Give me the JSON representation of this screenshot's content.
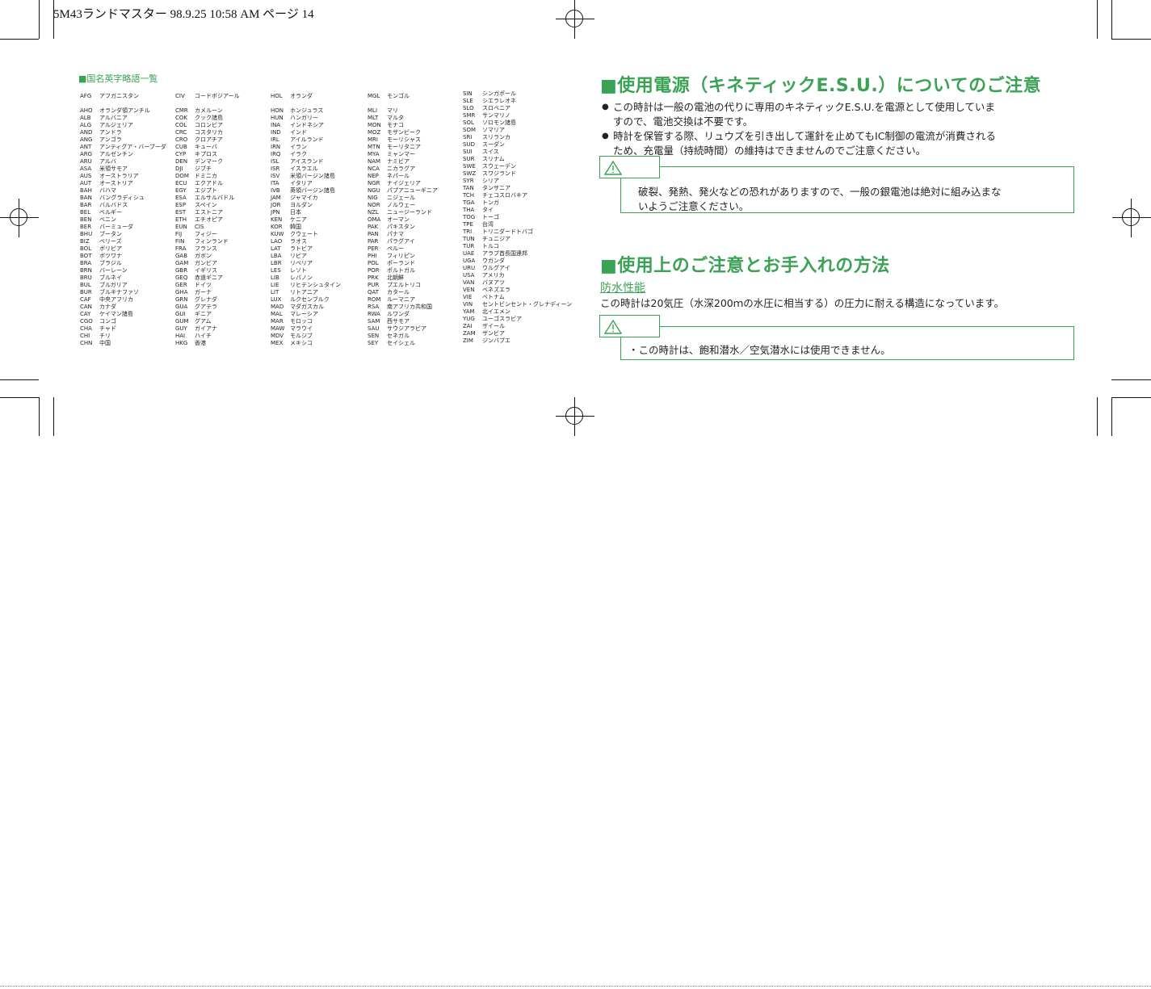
{
  "header": {
    "text": "5M43ランドマスター  98.9.25 10:58 AM   ページ 14"
  },
  "left_page": {
    "title": "■国名英字略語一覧",
    "columns": [
      [
        {
          "code": "AFG",
          "name": "アフガニスタン"
        },
        {
          "code": "",
          "name": ""
        },
        {
          "code": "AHO",
          "name": "オランダ領アンチル"
        },
        {
          "code": "ALB",
          "name": "アルバニア"
        },
        {
          "code": "ALG",
          "name": "アルジェリア"
        },
        {
          "code": "AND",
          "name": "アンドラ"
        },
        {
          "code": "ANG",
          "name": "アンゴラ"
        },
        {
          "code": "ANT",
          "name": "アンティグア・バーブーダ"
        },
        {
          "code": "ARG",
          "name": "アルゼンチン"
        },
        {
          "code": "ARU",
          "name": "アルバ"
        },
        {
          "code": "ASA",
          "name": "米領サモア"
        },
        {
          "code": "AUS",
          "name": "オーストラリア"
        },
        {
          "code": "AUT",
          "name": "オーストリア"
        },
        {
          "code": "BAH",
          "name": "バハマ"
        },
        {
          "code": "BAN",
          "name": "バングラディシュ"
        },
        {
          "code": "BAR",
          "name": "バルバドス"
        },
        {
          "code": "BEL",
          "name": "ベルギー"
        },
        {
          "code": "BEN",
          "name": "ベニン"
        },
        {
          "code": "BER",
          "name": "バーミューダ"
        },
        {
          "code": "BHU",
          "name": "ブータン"
        },
        {
          "code": "BIZ",
          "name": "ベリーズ"
        },
        {
          "code": "BOL",
          "name": "ボリビア"
        },
        {
          "code": "BOT",
          "name": "ボツワナ"
        },
        {
          "code": "BRA",
          "name": "ブラジル"
        },
        {
          "code": "BRN",
          "name": "バーレーン"
        },
        {
          "code": "BRU",
          "name": "ブルネイ"
        },
        {
          "code": "BUL",
          "name": "ブルガリア"
        },
        {
          "code": "BUR",
          "name": "ブルキナファソ"
        },
        {
          "code": "CAF",
          "name": "中央アフリカ"
        },
        {
          "code": "CAN",
          "name": "カナダ"
        },
        {
          "code": "CAY",
          "name": "ケイマン諸島"
        },
        {
          "code": "CGO",
          "name": "コンゴ"
        },
        {
          "code": "CHA",
          "name": "チャド"
        },
        {
          "code": "CHI",
          "name": "チリ"
        },
        {
          "code": "CHN",
          "name": "中国"
        }
      ],
      [
        {
          "code": "CIV",
          "name": "コードボジアール"
        },
        {
          "code": "",
          "name": ""
        },
        {
          "code": "CMR",
          "name": "カメルーン"
        },
        {
          "code": "COK",
          "name": "クック諸島"
        },
        {
          "code": "COL",
          "name": "コロンビア"
        },
        {
          "code": "CRC",
          "name": "コスタリカ"
        },
        {
          "code": "CRO",
          "name": "クロアチア"
        },
        {
          "code": "CUB",
          "name": "キューバ"
        },
        {
          "code": "CYP",
          "name": "キプロス"
        },
        {
          "code": "DEN",
          "name": "デンマーク"
        },
        {
          "code": "DJI",
          "name": "ジブチ"
        },
        {
          "code": "DOM",
          "name": "ドミニカ"
        },
        {
          "code": "ECU",
          "name": "エクアドル"
        },
        {
          "code": "EGY",
          "name": "エジプト"
        },
        {
          "code": "ESA",
          "name": "エルサルバドル"
        },
        {
          "code": "ESP",
          "name": "スペイン"
        },
        {
          "code": "EST",
          "name": "エストニア"
        },
        {
          "code": "ETH",
          "name": "エチオピア"
        },
        {
          "code": "EUN",
          "name": "CIS"
        },
        {
          "code": "FIJ",
          "name": "フィジー"
        },
        {
          "code": "FIN",
          "name": "フィンランド"
        },
        {
          "code": "FRA",
          "name": "フランス"
        },
        {
          "code": "GAB",
          "name": "ガボン"
        },
        {
          "code": "GAM",
          "name": "ガンビア"
        },
        {
          "code": "GBR",
          "name": "イギリス"
        },
        {
          "code": "GEQ",
          "name": "赤道ギニア"
        },
        {
          "code": "GER",
          "name": "ドイツ"
        },
        {
          "code": "GHA",
          "name": "ガーナ"
        },
        {
          "code": "GRN",
          "name": "グレナダ"
        },
        {
          "code": "GUA",
          "name": "グアテラ"
        },
        {
          "code": "GUI",
          "name": "ギニア"
        },
        {
          "code": "GUM",
          "name": "グアム"
        },
        {
          "code": "GUY",
          "name": "ガイアナ"
        },
        {
          "code": "HAI",
          "name": "ハイチ"
        },
        {
          "code": "HKG",
          "name": "香港"
        }
      ],
      [
        {
          "code": "HOL",
          "name": "オランダ"
        },
        {
          "code": "",
          "name": ""
        },
        {
          "code": "HON",
          "name": "ホンジュラス"
        },
        {
          "code": "HUN",
          "name": "ハンガリー"
        },
        {
          "code": "INA",
          "name": "インドネシア"
        },
        {
          "code": "IND",
          "name": "インド"
        },
        {
          "code": "IRL",
          "name": "アイルランド"
        },
        {
          "code": "IRN",
          "name": "イラン"
        },
        {
          "code": "IRQ",
          "name": "イラク"
        },
        {
          "code": "ISL",
          "name": "アイスランド"
        },
        {
          "code": "ISR",
          "name": "イスラエル"
        },
        {
          "code": "ISV",
          "name": "米領バージン諸島"
        },
        {
          "code": "ITA",
          "name": "イタリア"
        },
        {
          "code": "IVB",
          "name": "英領バージン諸島"
        },
        {
          "code": "JAM",
          "name": "ジャマイカ"
        },
        {
          "code": "JOR",
          "name": "ヨルダン"
        },
        {
          "code": "JPN",
          "name": "日本"
        },
        {
          "code": "KEN",
          "name": "ケニア"
        },
        {
          "code": "KOR",
          "name": "韓国"
        },
        {
          "code": "KUW",
          "name": "クウェート"
        },
        {
          "code": "LAO",
          "name": "ラオス"
        },
        {
          "code": "LAT",
          "name": "ラトビア"
        },
        {
          "code": "LBA",
          "name": "リビア"
        },
        {
          "code": "LBR",
          "name": "リベリア"
        },
        {
          "code": "LES",
          "name": "レソト"
        },
        {
          "code": "LIB",
          "name": "レバノン"
        },
        {
          "code": "LIE",
          "name": "リヒテンシュタイン"
        },
        {
          "code": "LIT",
          "name": "リトアニア"
        },
        {
          "code": "LUX",
          "name": "ルクセンブルク"
        },
        {
          "code": "MAD",
          "name": "マダガスカル"
        },
        {
          "code": "MAL",
          "name": "マレーシア"
        },
        {
          "code": "MAR",
          "name": "モロッコ"
        },
        {
          "code": "MAW",
          "name": "マラウイ"
        },
        {
          "code": "MDV",
          "name": "モルジブ"
        },
        {
          "code": "MEX",
          "name": "メキシコ"
        }
      ],
      [
        {
          "code": "MGL",
          "name": "モンゴル"
        },
        {
          "code": "",
          "name": ""
        },
        {
          "code": "MLI",
          "name": "マリ"
        },
        {
          "code": "MLT",
          "name": "マルタ"
        },
        {
          "code": "MON",
          "name": "モナコ"
        },
        {
          "code": "MOZ",
          "name": "モザンビーク"
        },
        {
          "code": "MRI",
          "name": "モーリシャス"
        },
        {
          "code": "MTN",
          "name": "モーリタニア"
        },
        {
          "code": "MYA",
          "name": "ミャンマー"
        },
        {
          "code": "NAM",
          "name": "ナミビア"
        },
        {
          "code": "NCA",
          "name": "ニカラグア"
        },
        {
          "code": "NEP",
          "name": "ネパール"
        },
        {
          "code": "NGR",
          "name": "ナイジェリア"
        },
        {
          "code": "NGU",
          "name": "パプアニューギニア"
        },
        {
          "code": "NIG",
          "name": "ニジェール"
        },
        {
          "code": "NOR",
          "name": "ノルウェー"
        },
        {
          "code": "NZL",
          "name": "ニュージーランド"
        },
        {
          "code": "OMA",
          "name": "オーマン"
        },
        {
          "code": "PAK",
          "name": "パキスタン"
        },
        {
          "code": "PAN",
          "name": "パナマ"
        },
        {
          "code": "PAR",
          "name": "パラグアイ"
        },
        {
          "code": "PER",
          "name": "ペルー"
        },
        {
          "code": "PHI",
          "name": "フィリピン"
        },
        {
          "code": "POL",
          "name": "ポーランド"
        },
        {
          "code": "POR",
          "name": "ポルトガル"
        },
        {
          "code": "PRK",
          "name": "北朝鮮"
        },
        {
          "code": "PUR",
          "name": "プエルトリコ"
        },
        {
          "code": "QAT",
          "name": "カタール"
        },
        {
          "code": "ROM",
          "name": "ルーマニア"
        },
        {
          "code": "RSA",
          "name": "南アフリカ共和国"
        },
        {
          "code": "RWA",
          "name": "ルワンダ"
        },
        {
          "code": "SAM",
          "name": "西サモア"
        },
        {
          "code": "SAU",
          "name": "サウジアラビア"
        },
        {
          "code": "SEN",
          "name": "セネガル"
        },
        {
          "code": "SEY",
          "name": "セイシェル"
        }
      ],
      [
        {
          "code": "SIN",
          "name": "シンガポール"
        },
        {
          "code": "SLE",
          "name": "シエラレオネ"
        },
        {
          "code": "SLO",
          "name": "スロベニア"
        },
        {
          "code": "SMR",
          "name": "サンマリノ"
        },
        {
          "code": "SOL",
          "name": "ソロモン諸島"
        },
        {
          "code": "SOM",
          "name": "ソマリア"
        },
        {
          "code": "SRI",
          "name": "スリランカ"
        },
        {
          "code": "SUD",
          "name": "スーダン"
        },
        {
          "code": "SUI",
          "name": "スイス"
        },
        {
          "code": "SUR",
          "name": "スリナム"
        },
        {
          "code": "SWE",
          "name": "スウェーデン"
        },
        {
          "code": "SWZ",
          "name": "スワジランド"
        },
        {
          "code": "SYR",
          "name": "シリア"
        },
        {
          "code": "TAN",
          "name": "タンザニア"
        },
        {
          "code": "TCH",
          "name": "チェコスロバキア"
        },
        {
          "code": "TGA",
          "name": "トンガ"
        },
        {
          "code": "THA",
          "name": "タイ"
        },
        {
          "code": "TOG",
          "name": "トーゴ"
        },
        {
          "code": "TPE",
          "name": "台湾"
        },
        {
          "code": "TRI",
          "name": "トリニダードトバゴ"
        },
        {
          "code": "TUN",
          "name": "チュニジア"
        },
        {
          "code": "TUR",
          "name": "トルコ"
        },
        {
          "code": "UAE",
          "name": "アラブ首長国連邦"
        },
        {
          "code": "UGA",
          "name": "ウガンダ"
        },
        {
          "code": "URU",
          "name": "ウルグアイ"
        },
        {
          "code": "USA",
          "name": "アメリカ"
        },
        {
          "code": "VAN",
          "name": "バヌアツ"
        },
        {
          "code": "VEN",
          "name": "ベネズエラ"
        },
        {
          "code": "VIE",
          "name": "ベトナム"
        },
        {
          "code": "VIN",
          "name": "セントビンセント・グレナディーン"
        },
        {
          "code": "YAM",
          "name": "北イエメン"
        },
        {
          "code": "YUG",
          "name": "ユーゴスラビア"
        },
        {
          "code": "ZAI",
          "name": "ザイール"
        },
        {
          "code": "ZAM",
          "name": "ザンビア"
        },
        {
          "code": "ZIM",
          "name": "ジンバブエ"
        }
      ]
    ]
  },
  "right_page": {
    "section1": {
      "title": "■使用電源（キネティックE.S.U.）についてのご注意",
      "bullet1_line1": "この時計は一般の電池の代りに専用のキネティックE.S.U.を電源として使用していま",
      "bullet1_line2": "すので、電池交換は不要です。",
      "bullet2_line1": "時計を保管する際、リュウズを引き出して運針を止めてもIC制御の電流が消費される",
      "bullet2_line2": "ため、充電量（持続時間）の維持はできませんのでご注意ください。",
      "warning_line1": "破裂、発熱、発火などの恐れがありますので、一般の銀電池は絶対に組み込まな",
      "warning_line2": "いようご注意ください。"
    },
    "section2": {
      "title": "■使用上のご注意とお手入れの方法",
      "subhead": "防水性能",
      "body": "この時計は20気圧（水深200ｍの水圧に相当する）の圧力に耐える構造になっています。",
      "warning": "・この時計は、飽和潜水／空気潜水には使用できません。"
    },
    "accent_color": "#3aa254"
  },
  "icons": {
    "warning": "warning-triangle-icon",
    "registration": "registration-mark-icon"
  }
}
